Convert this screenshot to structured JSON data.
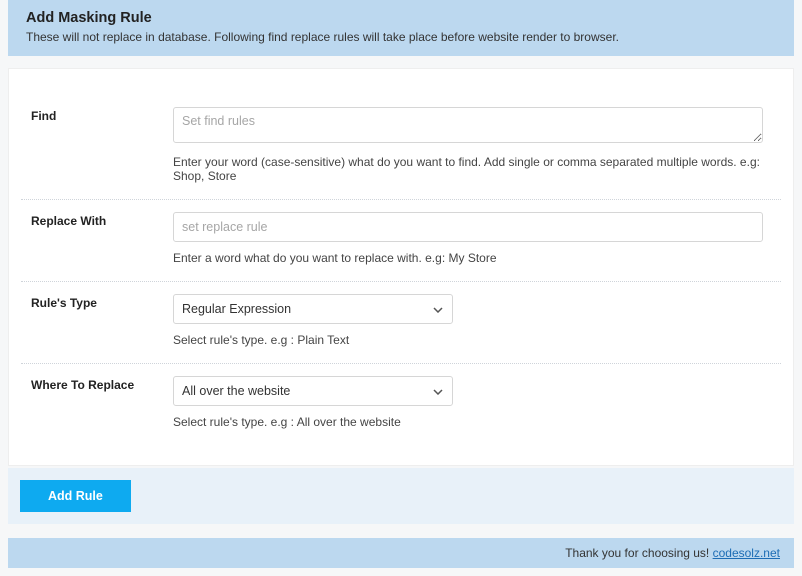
{
  "header": {
    "title": "Add Masking Rule",
    "subtitle": "These will not replace in database. Following find replace rules will take place before website render to browser."
  },
  "fields": {
    "find": {
      "label": "Find",
      "placeholder": "Set find rules",
      "hint": "Enter your word (case-sensitive) what do you want to find. Add single or comma separated multiple words. e.g: Shop, Store"
    },
    "replace": {
      "label": "Replace With",
      "placeholder": "set replace rule",
      "hint": "Enter a word what do you want to replace with. e.g: My Store"
    },
    "rule_type": {
      "label": "Rule's Type",
      "selected": "Regular Expression",
      "hint": "Select rule's type. e.g : Plain Text"
    },
    "where": {
      "label": "Where To Replace",
      "selected": "All over the website",
      "hint": "Select rule's type. e.g : All over the website"
    }
  },
  "actions": {
    "submit": "Add Rule"
  },
  "footer": {
    "thanks": "Thank you for choosing us! ",
    "link_text": "codesolz.net"
  }
}
